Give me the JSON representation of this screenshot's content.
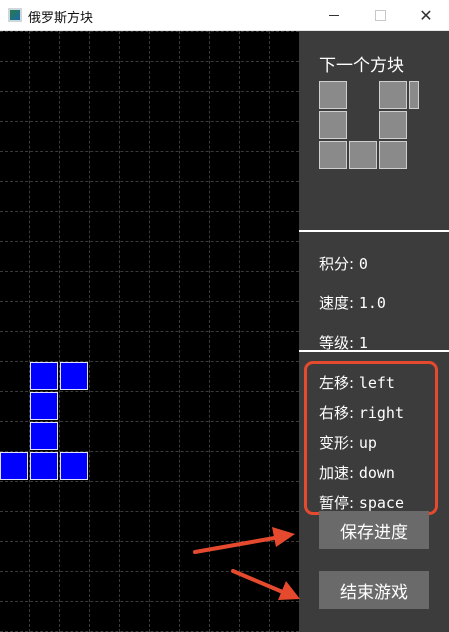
{
  "window": {
    "title": "俄罗斯方块",
    "minimize_icon": "minimize-icon",
    "maximize_icon": "maximize-icon",
    "close_icon": "close-icon"
  },
  "board": {
    "background": "#000000",
    "block_color": "#0000ff"
  },
  "panel": {
    "next_title": "下一个方块",
    "stats": [
      {
        "label": "积分: ",
        "value": "0"
      },
      {
        "label": "速度: ",
        "value": "1.0"
      },
      {
        "label": "等级: ",
        "value": "1"
      }
    ],
    "controls": [
      {
        "label": "左移: ",
        "key": "left"
      },
      {
        "label": "右移: ",
        "key": "right"
      },
      {
        "label": "变形: ",
        "key": "up"
      },
      {
        "label": "加速: ",
        "key": "down"
      },
      {
        "label": "暂停: ",
        "key": "space"
      }
    ],
    "save_button": "保存进度",
    "end_button": "结束游戏",
    "highlight_color": "#e64a2e"
  }
}
